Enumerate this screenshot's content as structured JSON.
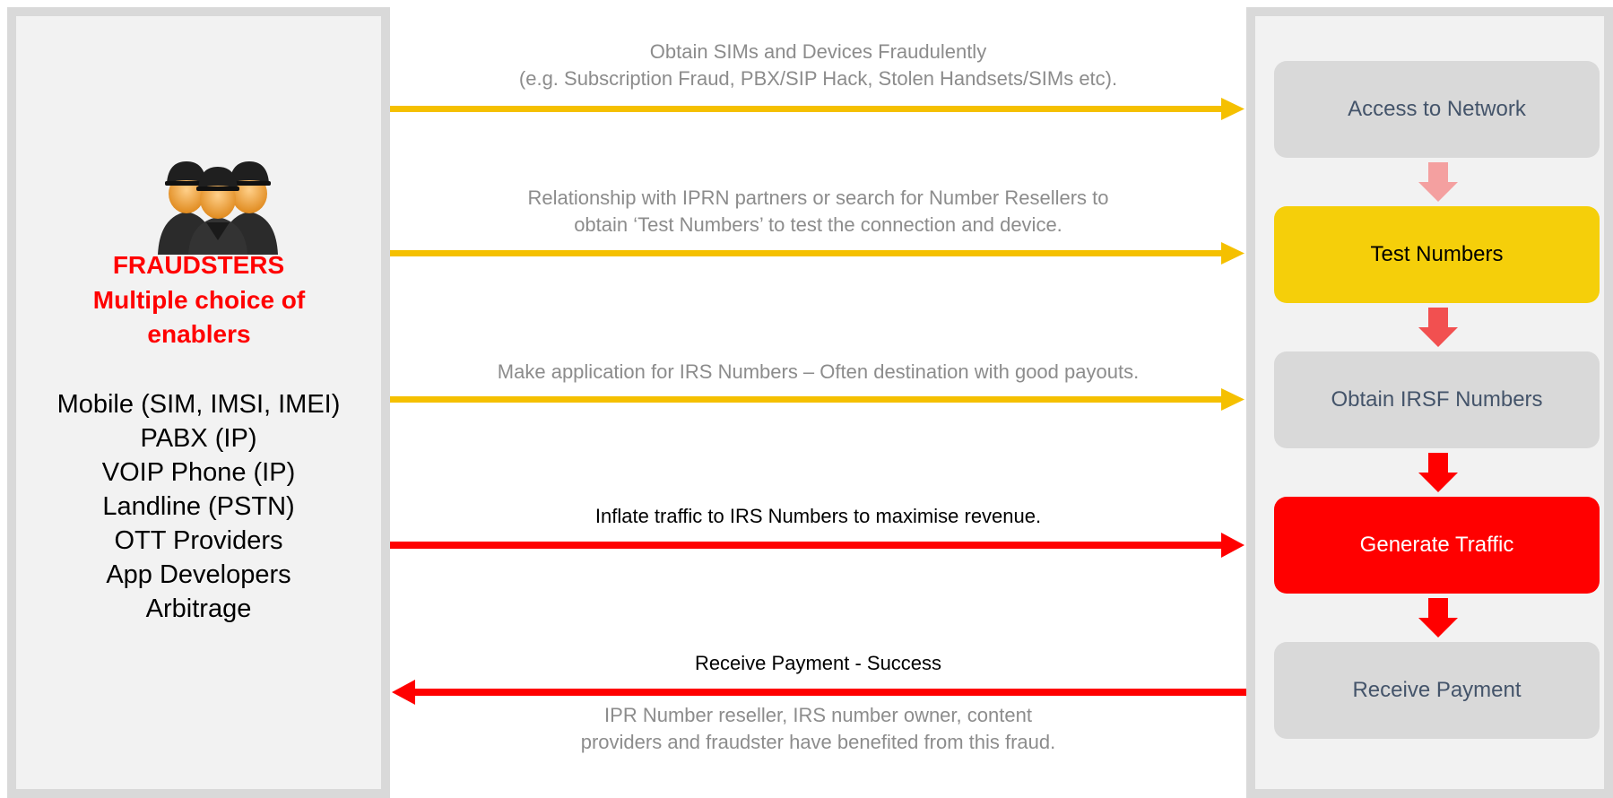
{
  "colors": {
    "panel_fill": "#f2f2f2",
    "panel_border": "#d9d9d9",
    "yellow_arrow": "#f5c000",
    "red_arrow": "#ff0000",
    "heading_red": "#ff0000",
    "step_grey": "#d9d9d9",
    "step_yellow": "#f5cf0a",
    "step_red": "#ff0000",
    "flow_text_grey": "#8c8c8c"
  },
  "fraudsters": {
    "icon": "fraudsters-group-icon",
    "title": "FRAUDSTERS",
    "subtitle": "Multiple choice of enablers",
    "enablers": [
      "Mobile (SIM, IMSI, IMEI)",
      "PABX (IP)",
      "VOIP Phone (IP)",
      "Landline (PSTN)",
      "OTT Providers",
      "App Developers",
      "Arbitrage"
    ]
  },
  "flows": [
    {
      "text_lines": [
        "Obtain SIMs and Devices Fraudulently",
        "(e.g. Subscription Fraud, PBX/SIP Hack, Stolen Handsets/SIMs etc)."
      ],
      "color": "yellow",
      "direction": "right"
    },
    {
      "text_lines": [
        "Relationship with IPRN partners or search for Number Resellers to",
        "obtain ‘Test Numbers’ to test the connection and device."
      ],
      "color": "yellow",
      "direction": "right"
    },
    {
      "text_lines": [
        "Make application for IRS Numbers – Often destination with good payouts."
      ],
      "color": "yellow",
      "direction": "right"
    },
    {
      "text_lines": [
        "Inflate traffic to IRS Numbers to maximise revenue."
      ],
      "color": "red",
      "direction": "right"
    },
    {
      "text_lines": [
        "Receive Payment - Success"
      ],
      "color": "red",
      "direction": "left",
      "note_lines": [
        "IPR Number reseller, IRS number owner, content",
        "providers and fraudster have benefited from this fraud."
      ]
    }
  ],
  "steps": [
    {
      "label": "Access to Network",
      "style": "grey"
    },
    {
      "label": "Test Numbers",
      "style": "yellow"
    },
    {
      "label": "Obtain IRSF Numbers",
      "style": "grey"
    },
    {
      "label": "Generate Traffic",
      "style": "red"
    },
    {
      "label": "Receive Payment",
      "style": "grey"
    }
  ],
  "step_arrows": [
    {
      "color": "#f4a0a0"
    },
    {
      "color": "#f25050"
    },
    {
      "color": "#ff0000"
    },
    {
      "color": "#ff0000"
    }
  ]
}
